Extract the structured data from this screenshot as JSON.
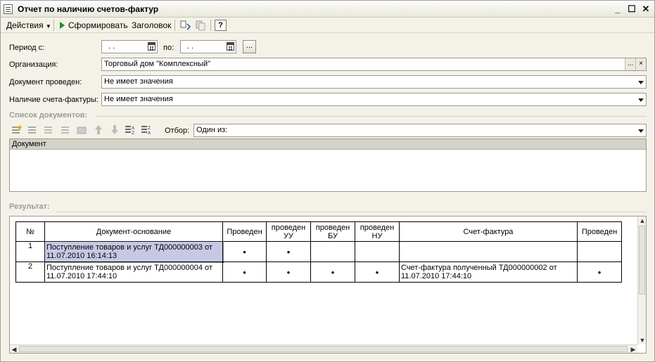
{
  "window": {
    "title": "Отчет по наличию счетов-фактур"
  },
  "toolbar": {
    "actions_label": "Действия",
    "generate_label": "Сформировать",
    "header_label": "Заголовок",
    "help_glyph": "?"
  },
  "form": {
    "period_from_label": "Период с:",
    "period_from_value": ".  .",
    "period_to_label": "по:",
    "period_to_value": ".  .",
    "period_btn": "...",
    "org_label": "Организация:",
    "org_value": "Торговый дом \"Комплексный\"",
    "org_btn": "...",
    "org_clear": "×",
    "doc_posted_label": "Документ проведен:",
    "doc_posted_value": "Не имеет значения",
    "invoice_presence_label": "Наличие счета-фактуры:",
    "invoice_presence_value": "Не имеет значения"
  },
  "doc_list": {
    "section_title": "Список документов:",
    "filter_label": "Отбор:",
    "filter_value": "Один из:",
    "column_header": "Документ"
  },
  "result": {
    "section_title": "Результат:",
    "headers": {
      "num": "№",
      "doc": "Документ-основание",
      "posted": "Проведен",
      "posted_uu_1": "проведен",
      "posted_uu_2": "УУ",
      "posted_bu_1": "проведен",
      "posted_bu_2": "БУ",
      "posted_nu_1": "проведен",
      "posted_nu_2": "НУ",
      "invoice": "Счет-фактура",
      "invoice_posted": "Проведен"
    },
    "rows": [
      {
        "num": "1",
        "doc": "Поступление товаров и услуг ТД000000003 от 11.07.2010 16:14:13",
        "posted": "•",
        "uu": "•",
        "bu": "",
        "nu": "",
        "invoice": "",
        "invoice_posted": ""
      },
      {
        "num": "2",
        "doc": "Поступление товаров и услуг ТД000000004 от 11.07.2010 17:44:10",
        "posted": "•",
        "uu": "•",
        "bu": "•",
        "nu": "•",
        "invoice": "Счет-фактура полученный ТД000000002 от 11.07.2010 17:44:10",
        "invoice_posted": "•"
      }
    ]
  },
  "colors": {
    "selection": "#c7c9e4",
    "accent_green": "#1e8f2a"
  }
}
